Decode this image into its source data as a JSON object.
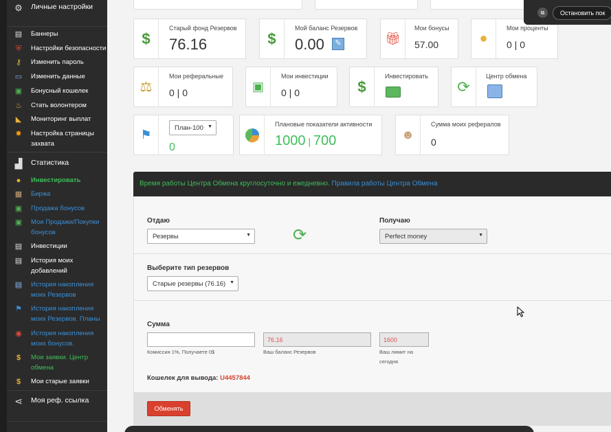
{
  "sidebar": {
    "items": [
      {
        "label": "Личные настройки",
        "icon": "gears-icon"
      },
      {
        "label": "Баннеры",
        "icon": "document-icon"
      },
      {
        "label": "Настройки безопасности",
        "icon": "shield-icon"
      },
      {
        "label": "Изменить пароль",
        "icon": "key-icon"
      },
      {
        "label": "Изменить данные",
        "icon": "id-card-icon"
      },
      {
        "label": "Бонусный кошелек",
        "icon": "money-icon"
      },
      {
        "label": "Стать волонтером",
        "icon": "cake-icon"
      },
      {
        "label": "Мониторинг выплат",
        "icon": "megaphone-icon"
      },
      {
        "label": "Настройка страницы захвата",
        "icon": "sun-icon"
      },
      {
        "label": "Статистика",
        "icon": "chart-icon"
      },
      {
        "label": "Инвестировать",
        "icon": "coins-icon"
      },
      {
        "label": "Биржа",
        "icon": "calculator-icon"
      },
      {
        "label": "Продажа бонусов",
        "icon": "money-icon"
      },
      {
        "label": "Мои Продажи/Покупки бонусов",
        "icon": "money-icon"
      },
      {
        "label": "Инвестиции",
        "icon": "document-icon"
      },
      {
        "label": "История моих добавлений",
        "icon": "document-icon"
      },
      {
        "label": "История накопления моих Резервов",
        "icon": "document-icon"
      },
      {
        "label": "История накопления моих Резервов. Планы",
        "icon": "flag-icon"
      },
      {
        "label": "История накопления моих бонусов.",
        "icon": "lifebuoy-icon"
      },
      {
        "label": "Мои заявки. Центр обмена",
        "icon": "dollar-icon"
      },
      {
        "label": "Мои старые заявки",
        "icon": "dollar-icon"
      },
      {
        "label": "Моя реф. ссылка",
        "icon": "share-icon"
      }
    ]
  },
  "cards": {
    "old_fund": {
      "title": "Старый фонд Резервов",
      "value": "76.16"
    },
    "my_balance": {
      "title": "Мой баланс Резервов",
      "value": "0.00"
    },
    "my_bonuses": {
      "title": "Мои бонусы",
      "value": "57.00"
    },
    "my_percent": {
      "title": "Мои проценты",
      "value": "0 | 0"
    },
    "my_referrals": {
      "title": "Мои реферальные",
      "value": "0 | 0"
    },
    "my_investments": {
      "title": "Мои инвестиции",
      "value": "0 | 0"
    },
    "invest": {
      "title": "Инвестировать"
    },
    "exchange_center": {
      "title": "Центр обмена"
    },
    "plan": {
      "select": "План-100",
      "value": "0"
    },
    "activity": {
      "title": "Плановые показатели активности",
      "value1": "1000",
      "value2": "700"
    },
    "ref_sum": {
      "title": "Сумма моих рефералов",
      "value": "0"
    }
  },
  "exchange": {
    "notice": "Время работы Центра Обмена круглосуточно и ежедневно.",
    "rules_link": "Правила работы Центра Обмена",
    "give_label": "Отдаю",
    "give_value": "Резервы",
    "receive_label": "Получаю",
    "receive_value": "Perfect money",
    "type_label": "Выберите тип резервов",
    "type_value": "Старые резервы (76.16)",
    "sum_label": "Сумма",
    "sum_value": "",
    "commission_hint": "Комиссия 1%, Получаете 0$",
    "balance_value": "76.16",
    "balance_hint": "Ваш баланс Резервов",
    "limit_value": "1600",
    "limit_hint": "Ваш лимит на сегодня",
    "wallet_label": "Кошелек для вывода:",
    "wallet_value": "U4457844",
    "submit_label": "Обменять"
  },
  "popup": {
    "label": "Остановить пок"
  },
  "colors": {
    "green": "#3fbf5a",
    "blue": "#3a8fd6",
    "red": "#d9412e",
    "sidebar": "#2b2b2b"
  }
}
